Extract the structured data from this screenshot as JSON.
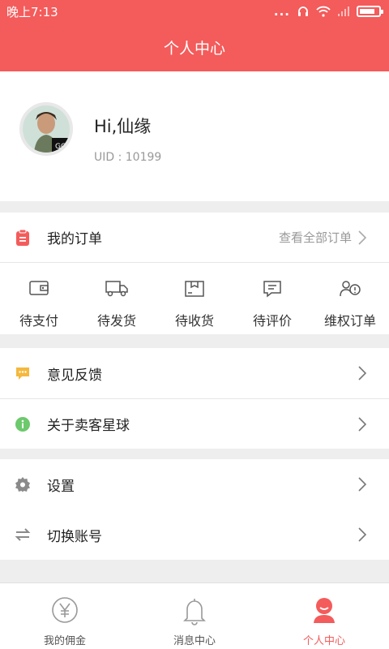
{
  "status_bar": {
    "time": "晚上7:13",
    "dots": "..."
  },
  "header": {
    "title": "个人中心"
  },
  "profile": {
    "greeting": "Hi,仙缘",
    "uid": "UID : 10199",
    "avatar_badge": "GO"
  },
  "orders": {
    "title": "我的订单",
    "view_all": "查看全部订单",
    "items": [
      {
        "label": "待支付",
        "icon": "wallet-icon"
      },
      {
        "label": "待发货",
        "icon": "truck-icon"
      },
      {
        "label": "待收货",
        "icon": "package-icon"
      },
      {
        "label": "待评价",
        "icon": "comment-icon"
      },
      {
        "label": "维权订单",
        "icon": "support-icon"
      }
    ]
  },
  "menu1": [
    {
      "label": "意见反馈",
      "icon": "feedback-icon",
      "color": "#f5b83d"
    },
    {
      "label": "关于卖客星球",
      "icon": "info-icon",
      "color": "#6cc96c"
    }
  ],
  "menu2": [
    {
      "label": "设置",
      "icon": "gear-icon"
    },
    {
      "label": "切换账号",
      "icon": "swap-icon"
    }
  ],
  "tabbar": {
    "items": [
      {
        "label": "我的佣金",
        "icon": "yen-icon",
        "active": false
      },
      {
        "label": "消息中心",
        "icon": "bell-icon",
        "active": false
      },
      {
        "label": "个人中心",
        "icon": "person-icon",
        "active": true
      }
    ]
  },
  "colors": {
    "accent": "#f45b5b",
    "background": "#eeeeee"
  }
}
